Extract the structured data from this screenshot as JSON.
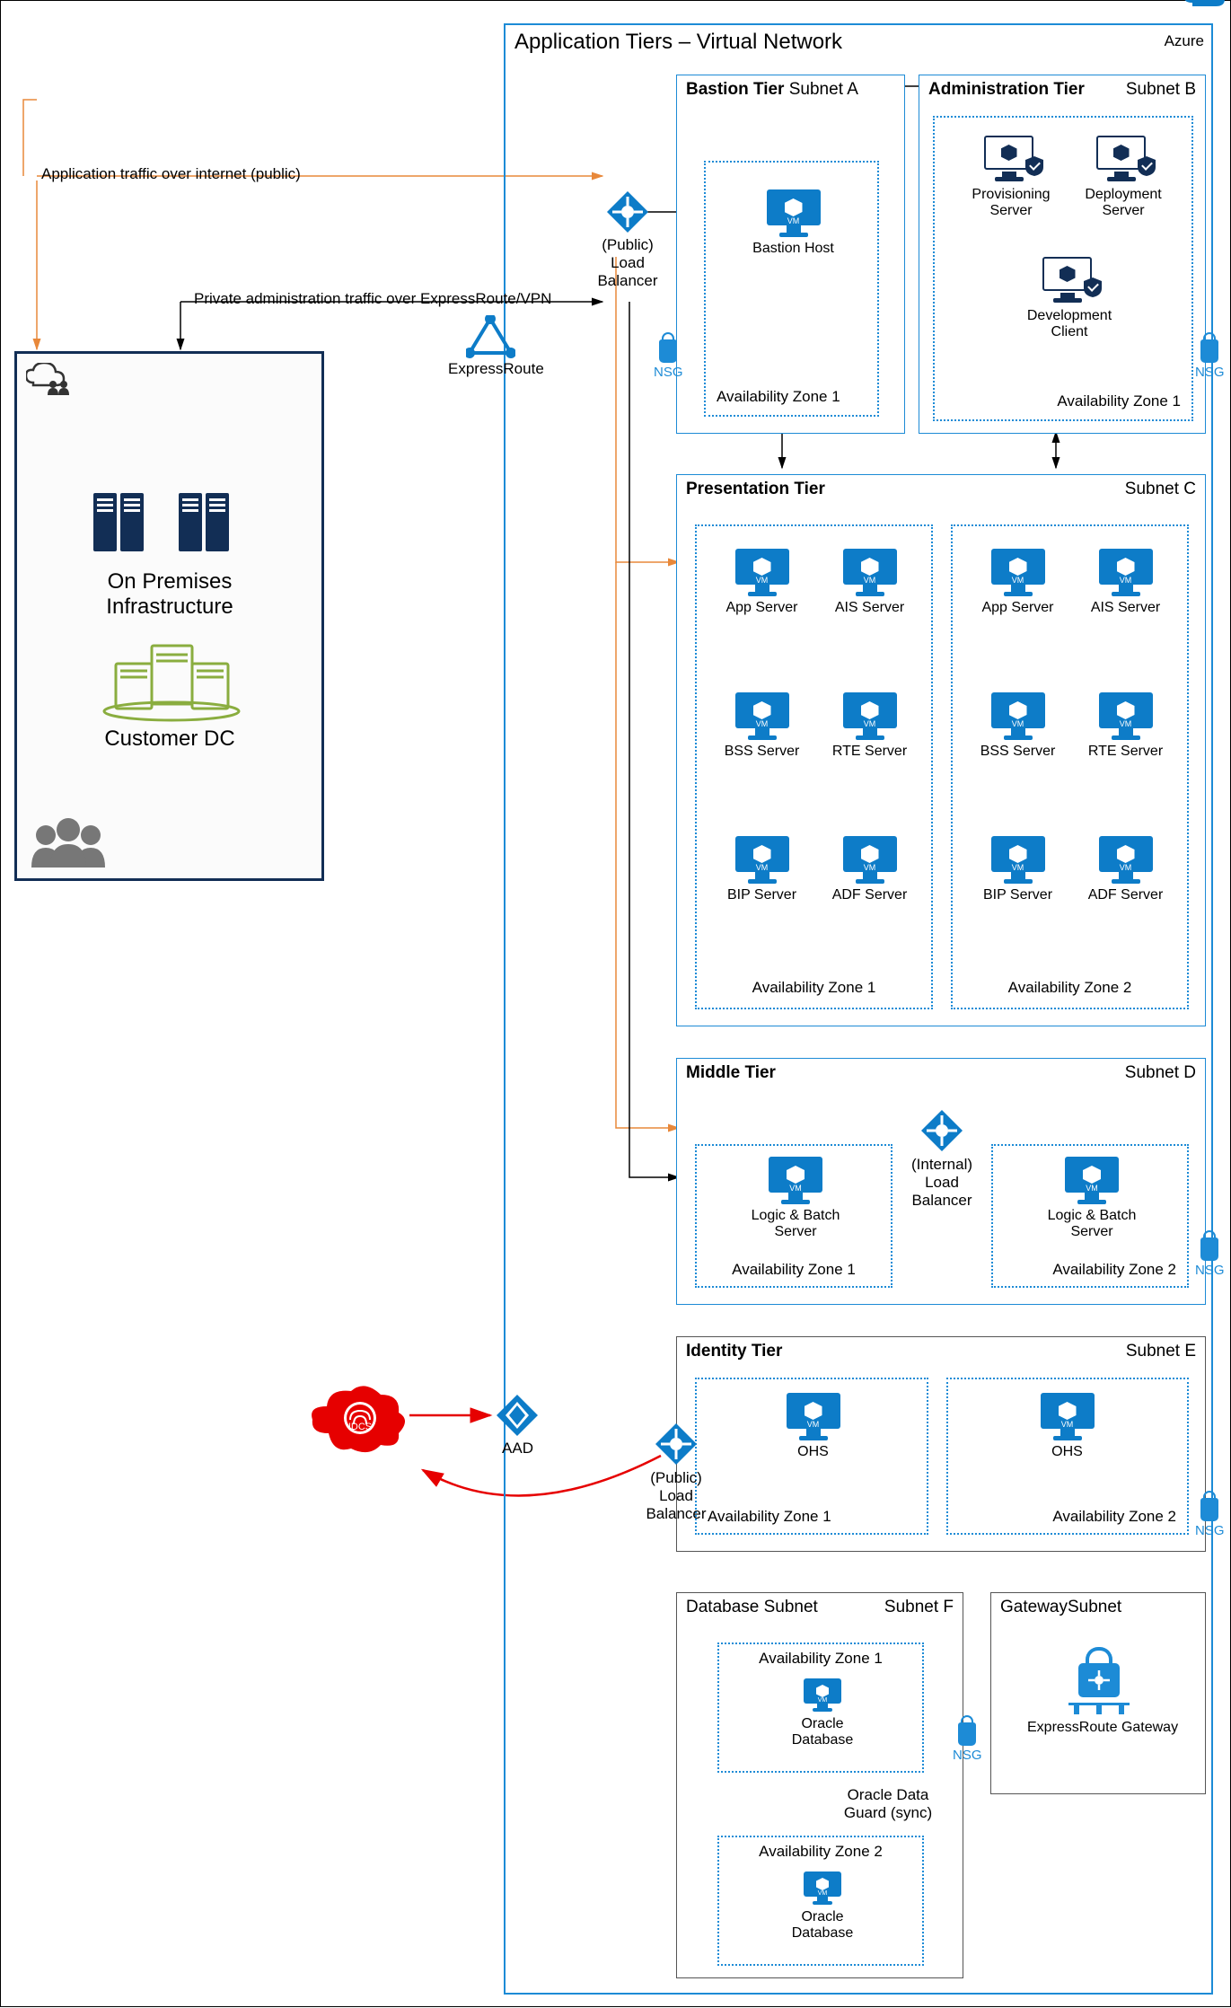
{
  "azure": {
    "label": "Azure"
  },
  "vnet": {
    "title": "Application Tiers – Virtual Network"
  },
  "traffic": {
    "public": "Application traffic over internet (public)",
    "private": "Private administration traffic over ExpressRoute/VPN"
  },
  "loadbalancers": {
    "public_top": "(Public)\nLoad Balancer",
    "internal": "(Internal)\nLoad Balancer",
    "public_identity": "(Public)\nLoad Balancer"
  },
  "expressroute": "ExpressRoute",
  "onprem": {
    "infra": "On Premises\nInfrastructure",
    "dc": "Customer DC"
  },
  "nsg": "NSG",
  "tiers": {
    "bastion": {
      "title": "Bastion Tier",
      "subnet": "Subnet A",
      "host": "Bastion Host",
      "az1": "Availability Zone 1"
    },
    "admin": {
      "title": "Administration Tier",
      "subnet": "Subnet B",
      "prov": "Provisioning\nServer",
      "deploy": "Deployment\nServer",
      "dev": "Development\nClient",
      "az1": "Availability Zone 1"
    },
    "presentation": {
      "title": "Presentation Tier",
      "subnet": "Subnet C",
      "vms": {
        "app": "App Server",
        "ais": "AIS Server",
        "bss": "BSS Server",
        "rte": "RTE Server",
        "bip": "BIP Server",
        "adf": "ADF Server"
      },
      "az1": "Availability Zone 1",
      "az2": "Availability Zone 2"
    },
    "middle": {
      "title": "Middle Tier",
      "subnet": "Subnet D",
      "logic": "Logic & Batch Server",
      "az1": "Availability Zone 1",
      "az2": "Availability Zone 2"
    },
    "identity": {
      "title": "Identity Tier",
      "subnet": "Subnet E",
      "ohs": "OHS",
      "az1": "Availability Zone 1",
      "az2": "Availability Zone 2"
    },
    "database": {
      "title": "Database Subnet",
      "subnet": "Subnet F",
      "az1": "Availability Zone 1",
      "az2": "Availability Zone 2",
      "oracle": "Oracle Database",
      "dataguard": "Oracle Data\nGuard (sync)"
    },
    "gateway": {
      "title": "GatewaySubnet",
      "gw": "ExpressRoute Gateway"
    }
  },
  "identity_ext": {
    "idcs": "IDCS",
    "aad": "AAD"
  }
}
